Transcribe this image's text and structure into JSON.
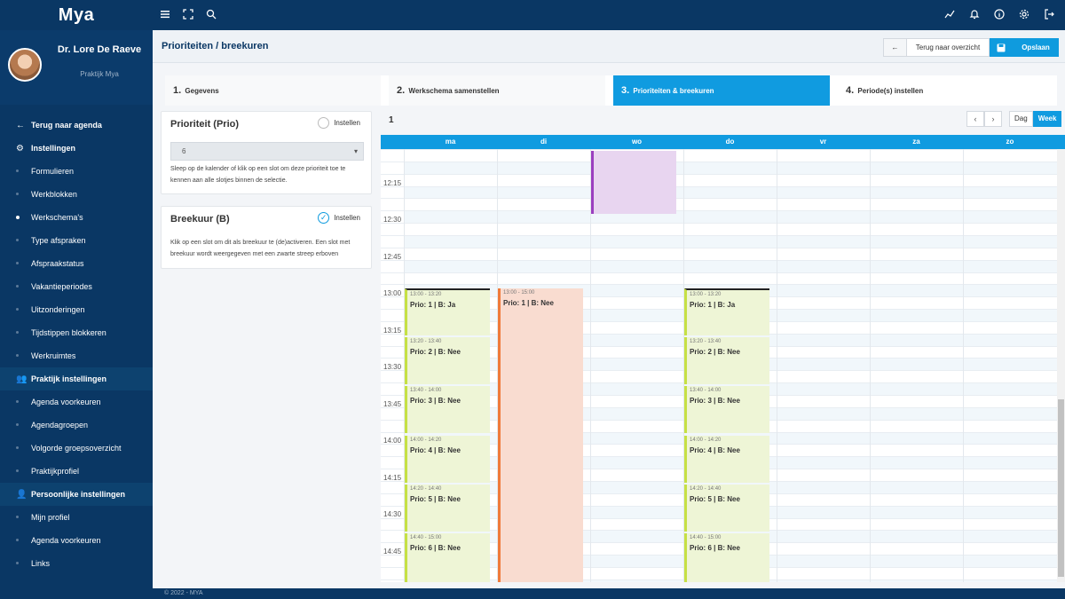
{
  "app": {
    "logo_text": "Mya"
  },
  "topbar": {
    "left_icons": [
      "menu-icon",
      "fullscreen-icon",
      "search-icon"
    ],
    "right_icons": [
      "chart-icon",
      "bell-icon",
      "info-icon",
      "gear-icon",
      "logout-icon"
    ]
  },
  "profile": {
    "name": "Dr. Lore De Raeve",
    "practice": "Praktijk Mya"
  },
  "sidebar": {
    "back": "Terug naar agenda",
    "settings": "Instellingen",
    "settings_items": [
      "Formulieren",
      "Werkblokken",
      "Werkschema's",
      "Type afspraken",
      "Afspraakstatus",
      "Vakantieperiodes",
      "Uitzonderingen",
      "Tijdstippen blokkeren",
      "Werkruimtes"
    ],
    "practice_section": "Praktijk instellingen",
    "practice_items": [
      "Agenda voorkeuren",
      "Agendagroepen",
      "Volgorde groepsoverzicht",
      "Praktijkprofiel"
    ],
    "personal_section": "Persoonlijke instellingen",
    "personal_items": [
      "Mijn profiel",
      "Agenda voorkeuren",
      "Links"
    ]
  },
  "header": {
    "title": "Prioriteiten / breekuren",
    "back_button": "Terug naar overzicht",
    "save_button": "Opslaan"
  },
  "steps": [
    {
      "num": "1.",
      "label": "Gegevens"
    },
    {
      "num": "2.",
      "label": "Werkschema samenstellen"
    },
    {
      "num": "3.",
      "label": "Prioriteiten & breekuren"
    },
    {
      "num": "4.",
      "label": "Periode(s) instellen"
    }
  ],
  "priority_panel": {
    "title": "Prioriteit (Prio)",
    "check_label": "Instellen",
    "select_value": "6",
    "description": "Sleep op de kalender of klik op een slot om deze prioriteit toe te kennen aan alle slotjes binnen de selectie."
  },
  "break_panel": {
    "title": "Breekuur (B)",
    "check_label": "Instellen",
    "description": "Klik op een slot om dit als breekuur te (de)activeren. Een slot met breekuur wordt weergegeven met een zwarte streep erboven"
  },
  "calendar": {
    "week": "1",
    "view_day": "Dag",
    "view_week": "Week",
    "days": [
      "ma",
      "di",
      "wo",
      "do",
      "vr",
      "za",
      "zo"
    ],
    "time_labels": [
      "12:15",
      "12:30",
      "12:45",
      "13:00",
      "13:15",
      "13:30",
      "13:45",
      "14:00",
      "14:15",
      "14:30",
      "14:45"
    ],
    "events_ma": [
      {
        "time": "13:00 - 13:20",
        "label": "Prio: 1 | B: Ja"
      },
      {
        "time": "13:20 - 13:40",
        "label": "Prio: 2 | B: Nee"
      },
      {
        "time": "13:40 - 14:00",
        "label": "Prio: 3 | B: Nee"
      },
      {
        "time": "14:00 - 14:20",
        "label": "Prio: 4 | B: Nee"
      },
      {
        "time": "14:20 - 14:40",
        "label": "Prio: 5 | B: Nee"
      },
      {
        "time": "14:40 - 15:00",
        "label": "Prio: 6 | B: Nee"
      }
    ],
    "event_di": {
      "time": "13:00 - 15:00",
      "label": "Prio: 1 | B: Nee"
    },
    "events_do": [
      {
        "time": "13:00 - 13:20",
        "label": "Prio: 1 | B: Ja"
      },
      {
        "time": "13:20 - 13:40",
        "label": "Prio: 2 | B: Nee"
      },
      {
        "time": "13:40 - 14:00",
        "label": "Prio: 3 | B: Nee"
      },
      {
        "time": "14:00 - 14:20",
        "label": "Prio: 4 | B: Nee"
      },
      {
        "time": "14:20 - 14:40",
        "label": "Prio: 5 | B: Nee"
      },
      {
        "time": "14:40 - 15:00",
        "label": "Prio: 6 | B: Nee"
      }
    ]
  },
  "footer": {
    "text": "© 2022 - MYA"
  },
  "colors": {
    "navy": "#0a3764",
    "accent": "#109be0",
    "prio_green": "#c6e044",
    "prio_red": "#f07a3a",
    "prio_purple": "#9b3fbf"
  }
}
